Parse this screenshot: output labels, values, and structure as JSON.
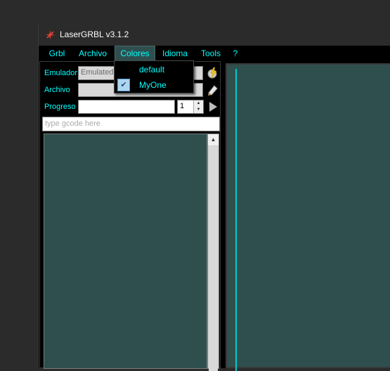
{
  "window": {
    "title": "LaserGRBL v3.1.2"
  },
  "menu": {
    "items": [
      {
        "label": "Grbl"
      },
      {
        "label": "Archivo"
      },
      {
        "label": "Colores"
      },
      {
        "label": "Idioma"
      },
      {
        "label": "Tools"
      },
      {
        "label": "?"
      }
    ]
  },
  "colores_menu": {
    "items": [
      {
        "label": "default",
        "checked": false
      },
      {
        "label": "MyOne",
        "checked": true
      }
    ]
  },
  "panel": {
    "emulador_label": "Emulador",
    "emulador_value": "Emulated C",
    "archivo_label": "Archivo",
    "archivo_value": "",
    "progreso_label": "Progreso",
    "progreso_value": "",
    "copies_value": "1",
    "gcode_placeholder": "type gcode here"
  },
  "colors": {
    "accent": "#00ffff",
    "preview_bg": "#2f4f4f",
    "menu_bg": "#000000"
  }
}
